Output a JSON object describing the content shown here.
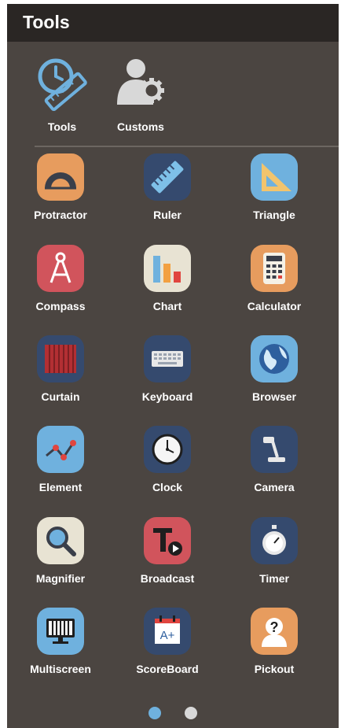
{
  "panel": {
    "title": "Tools"
  },
  "top_items": [
    {
      "label": "Tools",
      "icon": "tools-icon"
    },
    {
      "label": "Customs",
      "icon": "customs-icon"
    }
  ],
  "tools": [
    {
      "label": "Protractor",
      "icon": "protractor-icon",
      "bg": "#e79c5e"
    },
    {
      "label": "Ruler",
      "icon": "ruler-icon",
      "bg": "#354a6e"
    },
    {
      "label": "Triangle",
      "icon": "triangle-ruler-icon",
      "bg": "#6fb1de"
    },
    {
      "label": "Compass",
      "icon": "compass-icon",
      "bg": "#d1545c"
    },
    {
      "label": "Chart",
      "icon": "bar-chart-icon",
      "bg": "#e8e3d3"
    },
    {
      "label": "Calculator",
      "icon": "calculator-icon",
      "bg": "#e79c5e"
    },
    {
      "label": "Curtain",
      "icon": "curtain-icon",
      "bg": "#354a6e"
    },
    {
      "label": "Keyboard",
      "icon": "keyboard-icon",
      "bg": "#354a6e"
    },
    {
      "label": "Browser",
      "icon": "globe-icon",
      "bg": "#6fb1de"
    },
    {
      "label": "Element",
      "icon": "line-graph-icon",
      "bg": "#6fb1de"
    },
    {
      "label": "Clock",
      "icon": "clock-icon",
      "bg": "#354a6e"
    },
    {
      "label": "Camera",
      "icon": "document-camera-icon",
      "bg": "#354a6e"
    },
    {
      "label": "Magnifier",
      "icon": "magnifier-icon",
      "bg": "#e8e3d3"
    },
    {
      "label": "Broadcast",
      "icon": "broadcast-icon",
      "bg": "#d1545c"
    },
    {
      "label": "Timer",
      "icon": "stopwatch-icon",
      "bg": "#354a6e"
    },
    {
      "label": "Multiscreen",
      "icon": "monitor-icon",
      "bg": "#6fb1de"
    },
    {
      "label": "ScoreBoard",
      "icon": "scoreboard-icon",
      "bg": "#354a6e"
    },
    {
      "label": "Pickout",
      "icon": "pickout-icon",
      "bg": "#e79c5e"
    }
  ],
  "pagination": {
    "pages": 2,
    "active": 1,
    "active_color": "#6fb1de",
    "inactive_color": "#d8d8d8"
  }
}
